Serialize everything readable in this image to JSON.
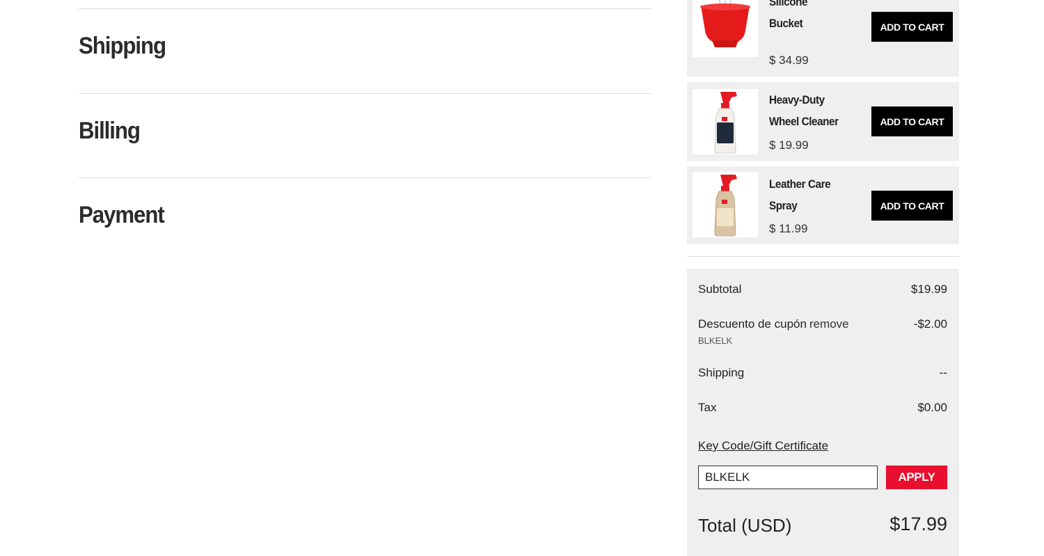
{
  "sections": {
    "shipping": "Shipping",
    "billing": "Billing",
    "payment": "Payment"
  },
  "products": [
    {
      "name_line1": "",
      "name_line2": "Silicone",
      "name_line3": "Bucket",
      "price": "$ 34.99",
      "button": "ADD TO CART",
      "icon": "bucket-icon"
    },
    {
      "name_line1": "Heavy-Duty",
      "name_line2": "Wheel Cleaner",
      "price": "$ 19.99",
      "button": "ADD TO CART",
      "icon": "spray-bottle-icon"
    },
    {
      "name_line1": "Leather Care",
      "name_line2": "Spray",
      "price": "$ 11.99",
      "button": "ADD TO CART",
      "icon": "spray-bottle-icon"
    }
  ],
  "summary": {
    "subtotal_label": "Subtotal",
    "subtotal_value": "$19.99",
    "discount_label": "Descuento de cupón",
    "discount_remove": "remove",
    "discount_code": "BLKELK",
    "discount_value": "-$2.00",
    "shipping_label": "Shipping",
    "shipping_value": "--",
    "tax_label": "Tax",
    "tax_value": "$0.00",
    "gift_link": "Key Code/Gift Certificate",
    "code_input_value": "BLKELK",
    "apply_label": "APPLY",
    "total_label": "Total (USD)",
    "total_value": "$17.99"
  },
  "colors": {
    "panel_bg": "#efefef",
    "button_black": "#000000",
    "apply_red": "#e8102e"
  }
}
